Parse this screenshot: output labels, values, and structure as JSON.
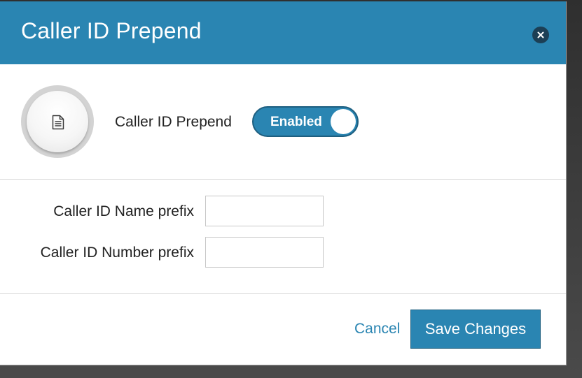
{
  "dialog": {
    "title": "Caller ID Prepend",
    "close_icon": "close-circle-icon"
  },
  "feature": {
    "icon": "document-icon",
    "label": "Caller ID Prepend",
    "toggle": {
      "state_label": "Enabled",
      "enabled": true
    }
  },
  "form": {
    "name_prefix": {
      "label": "Caller ID Name prefix",
      "value": ""
    },
    "number_prefix": {
      "label": "Caller ID Number prefix",
      "value": ""
    }
  },
  "actions": {
    "cancel_label": "Cancel",
    "save_label": "Save Changes"
  },
  "colors": {
    "accent": "#2a85b2",
    "close_button": "#1c3f55"
  }
}
